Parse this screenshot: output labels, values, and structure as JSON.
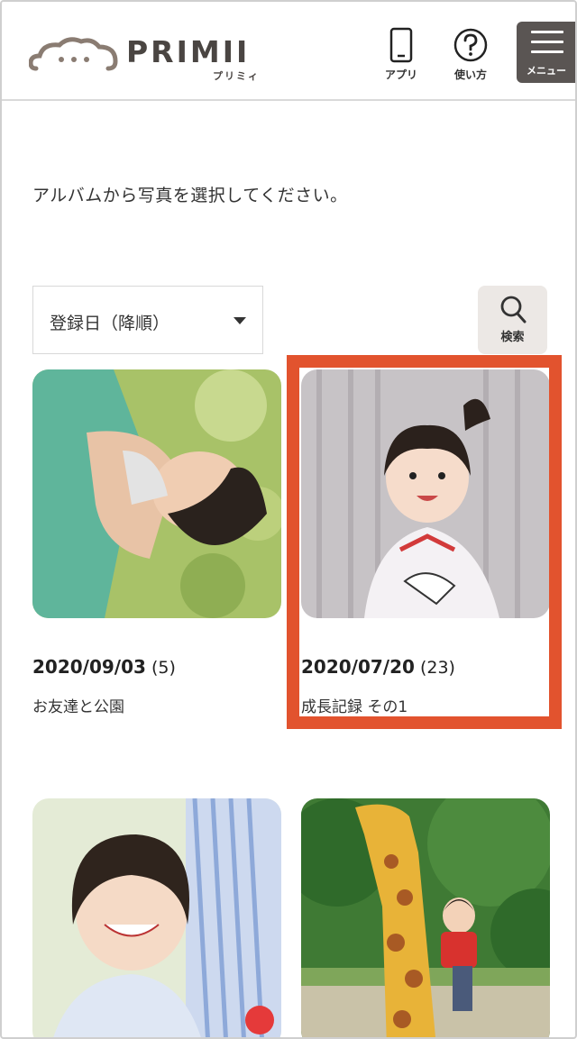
{
  "header": {
    "logo_text": "PRIMII",
    "logo_kana": "プリミィ",
    "app_label": "アプリ",
    "help_label": "使い方",
    "menu_label": "メニュー"
  },
  "instruction": "アルバムから写真を選択してください。",
  "sort": {
    "selected": "登録日（降順）"
  },
  "search": {
    "label": "検索"
  },
  "albums": [
    {
      "date": "2020/09/03",
      "count": "(5)",
      "name": "お友達と公園"
    },
    {
      "date": "2020/07/20",
      "count": "(23)",
      "name": "成長記録 その1"
    },
    {
      "date": "",
      "count": "",
      "name": ""
    },
    {
      "date": "",
      "count": "",
      "name": ""
    }
  ],
  "colors": {
    "accent": "#e2532e",
    "brand": "#5a5553",
    "search_bg": "#ece8e5"
  },
  "icons": [
    "cloud-logo-icon",
    "smartphone-icon",
    "question-icon",
    "hamburger-menu-icon",
    "search-icon",
    "dropdown-caret-icon"
  ]
}
